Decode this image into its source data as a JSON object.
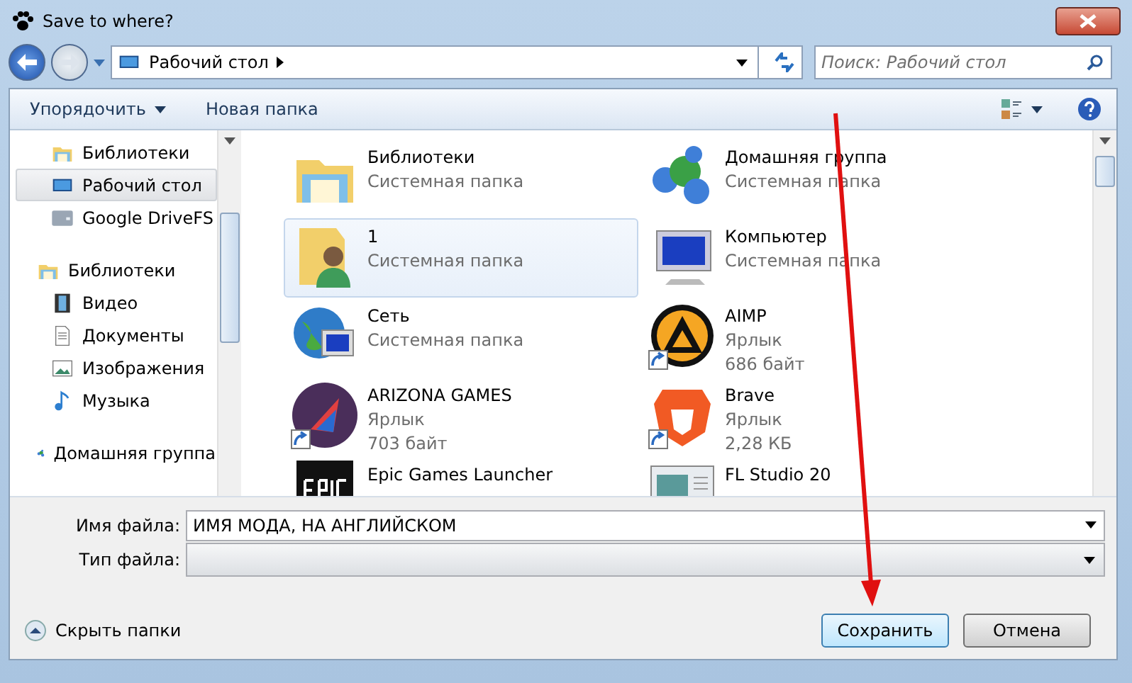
{
  "window": {
    "title": "Save to where?"
  },
  "address": {
    "location": "Рабочий стол",
    "search_placeholder": "Поиск: Рабочий стол"
  },
  "toolbar": {
    "organize": "Упорядочить",
    "new_folder": "Новая папка"
  },
  "sidebar": {
    "items": [
      {
        "label": "Библиотеки",
        "kind": "library",
        "selected": false
      },
      {
        "label": "Рабочий стол",
        "kind": "desktop",
        "selected": true
      },
      {
        "label": "Google DriveFS",
        "kind": "drive",
        "selected": false
      },
      {
        "label": "Библиотеки",
        "kind": "library",
        "selected": false,
        "children": [
          {
            "label": "Видео",
            "kind": "video",
            "selected": false
          },
          {
            "label": "Документы",
            "kind": "document",
            "selected": false
          },
          {
            "label": "Изображения",
            "kind": "image",
            "selected": false
          },
          {
            "label": "Музыка",
            "kind": "music",
            "selected": false
          }
        ]
      },
      {
        "label": "Домашняя группа",
        "kind": "homegroup",
        "selected": false
      }
    ]
  },
  "files": [
    {
      "name": "Библиотеки",
      "kind": "library",
      "shortcut": false,
      "selected": false,
      "lines": [
        "Системная папка"
      ]
    },
    {
      "name": "Домашняя группа",
      "kind": "homegroup",
      "shortcut": false,
      "selected": false,
      "lines": [
        "Системная папка"
      ]
    },
    {
      "name": "1",
      "kind": "user",
      "shortcut": false,
      "selected": true,
      "lines": [
        "Системная папка"
      ]
    },
    {
      "name": "Компьютер",
      "kind": "computer",
      "shortcut": false,
      "selected": false,
      "lines": [
        "Системная папка"
      ]
    },
    {
      "name": "Сеть",
      "kind": "network",
      "shortcut": false,
      "selected": false,
      "lines": [
        "Системная папка"
      ]
    },
    {
      "name": "AIMP",
      "kind": "aimp",
      "shortcut": true,
      "selected": false,
      "lines": [
        "Ярлык",
        "686 байт"
      ]
    },
    {
      "name": "ARIZONA GAMES",
      "kind": "arizona",
      "shortcut": true,
      "selected": false,
      "lines": [
        "Ярлык",
        "703 байт"
      ]
    },
    {
      "name": "Brave",
      "kind": "brave",
      "shortcut": true,
      "selected": false,
      "lines": [
        "Ярлык",
        "2,28 КБ"
      ]
    },
    {
      "name": "Epic Games Launcher",
      "kind": "epic",
      "shortcut": false,
      "selected": false
    },
    {
      "name": "FL Studio 20",
      "kind": "window",
      "shortcut": false,
      "selected": false
    }
  ],
  "form": {
    "filename_label": "Имя файла:",
    "filename_value": "ИМЯ МОДА, НА АНГЛИЙСКОМ",
    "filetype_label": "Тип файла:"
  },
  "footer": {
    "hide_folders": "Скрыть папки",
    "save": "Сохранить",
    "cancel": "Отмена"
  }
}
